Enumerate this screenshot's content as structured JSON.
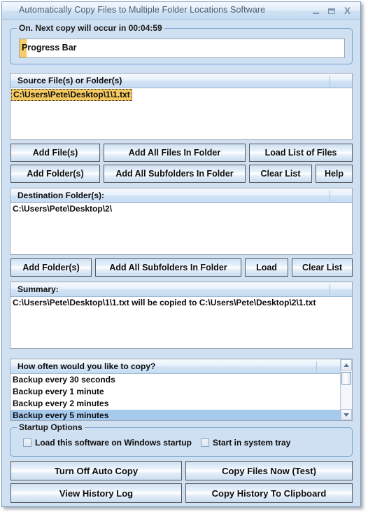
{
  "window": {
    "title": "Automatically Copy Files to Multiple Folder Locations Software",
    "controls": {
      "minimize": "minimize-icon",
      "maximize": "maximize-icon",
      "close": "X"
    }
  },
  "status_group": {
    "legend": "On. Next copy will occur in 00:04:59",
    "progress": {
      "text": "Progress Bar",
      "percent": 2,
      "fill_color": "#f5c95f"
    }
  },
  "source_list": {
    "header": "Source File(s) or Folder(s)",
    "items": [
      {
        "text": "C:\\Users\\Pete\\Desktop\\1\\1.txt",
        "selected": true
      }
    ]
  },
  "source_buttons": {
    "row1": [
      "Add File(s)",
      "Add All Files In Folder",
      "Load List of Files"
    ],
    "row2": [
      "Add Folder(s)",
      "Add All Subfolders In Folder",
      "Clear List",
      "Help"
    ]
  },
  "destination_list": {
    "header": "Destination Folder(s):",
    "items": [
      {
        "text": "C:\\Users\\Pete\\Desktop\\2\\",
        "selected": false
      }
    ]
  },
  "destination_buttons": [
    "Add Folder(s)",
    "Add All Subfolders In Folder",
    "Load",
    "Clear List"
  ],
  "summary_list": {
    "header": "Summary:",
    "items": [
      {
        "text": "C:\\Users\\Pete\\Desktop\\1\\1.txt will be copied to C:\\Users\\Pete\\Desktop\\2\\1.txt",
        "selected": false
      }
    ]
  },
  "frequency_list": {
    "header": "How often would you like to copy?",
    "items": [
      {
        "text": "Backup every 30 seconds",
        "selected": false
      },
      {
        "text": "Backup every 1 minute",
        "selected": false
      },
      {
        "text": "Backup every 2 minutes",
        "selected": false
      },
      {
        "text": "Backup every 5 minutes",
        "selected": true
      }
    ]
  },
  "startup_options": {
    "legend": "Startup Options",
    "checkboxes": [
      {
        "label": "Load this software on Windows startup",
        "checked": false
      },
      {
        "label": "Start in system tray",
        "checked": false
      }
    ]
  },
  "action_buttons": {
    "turn_off": "Turn Off Auto Copy",
    "copy_now": "Copy Files Now (Test)",
    "view_history": "View History Log",
    "copy_history": "Copy History To Clipboard"
  }
}
